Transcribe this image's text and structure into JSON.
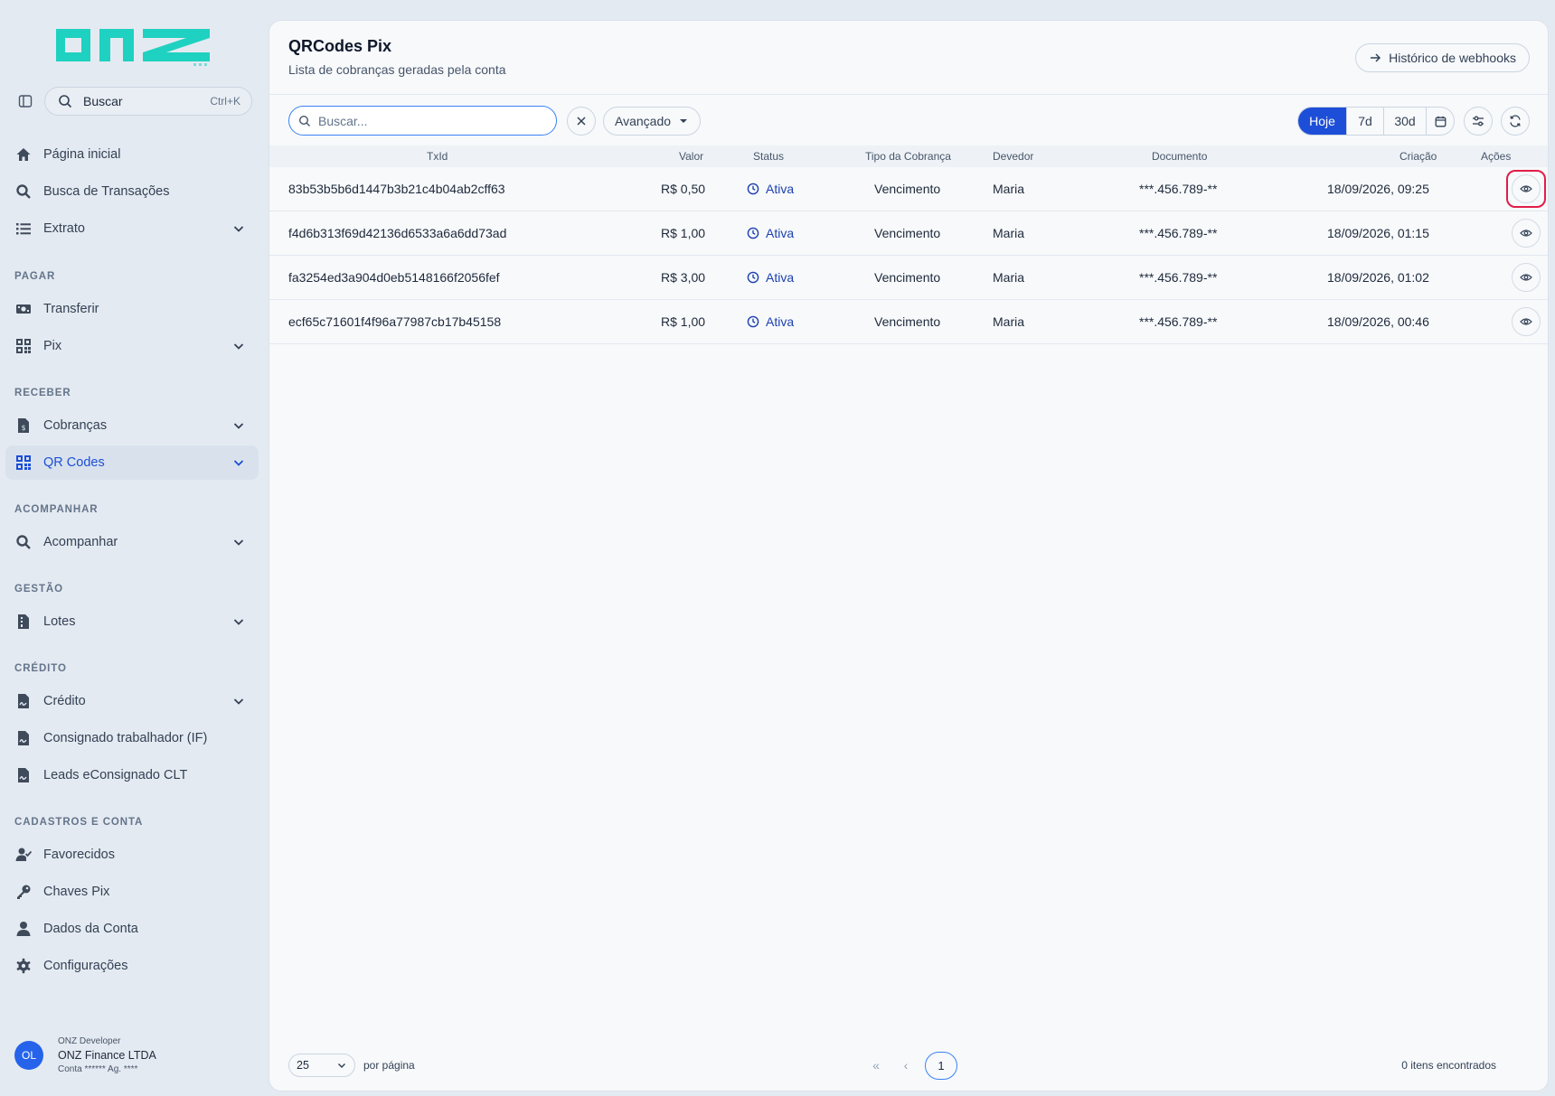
{
  "brand": {
    "logo_text": "onz",
    "accent": "#1fd1c1"
  },
  "sidebar": {
    "search": {
      "label": "Buscar",
      "shortcut": "Ctrl+K"
    },
    "items": [
      {
        "label": "Página inicial",
        "icon": "home-icon"
      },
      {
        "label": "Busca de Transações",
        "icon": "search-icon"
      },
      {
        "label": "Extrato",
        "icon": "list-icon"
      }
    ],
    "sections": {
      "pagar": "PAGAR",
      "receber": "RECEBER",
      "acompanhar": "ACOMPANHAR",
      "gestao": "GESTÃO",
      "credito": "CRÉDITO",
      "cadastros": "CADASTROS E CONTA"
    },
    "pagar": {
      "transferir": "Transferir",
      "pix": "Pix"
    },
    "receber": {
      "cobrancas": "Cobranças",
      "qrcodes": "QR Codes"
    },
    "acompanhar": {
      "acompanhar": "Acompanhar"
    },
    "gestao": {
      "lotes": "Lotes"
    },
    "credito": {
      "credito": "Crédito",
      "consignado": "Consignado trabalhador (IF)",
      "leads": "Leads eConsignado CLT"
    },
    "cadastros": {
      "favorecidos": "Favorecidos",
      "chaves": "Chaves Pix",
      "dados": "Dados da Conta",
      "config": "Configurações"
    },
    "user": {
      "initials": "OL",
      "role": "ONZ Developer",
      "name": "ONZ Finance LTDA",
      "account": "Conta ****** Ag. ****"
    }
  },
  "main": {
    "title": "QRCodes Pix",
    "subtitle": "Lista de cobranças geradas pela conta",
    "webhook_button": "Histórico de webhooks",
    "search_placeholder": "Buscar...",
    "advanced": "Avançado",
    "ranges": [
      "Hoje",
      "7d",
      "30d"
    ],
    "columns": {
      "txid": "TxId",
      "valor": "Valor",
      "status": "Status",
      "tipo": "Tipo da Cobrança",
      "devedor": "Devedor",
      "documento": "Documento",
      "criacao": "Criação",
      "acoes": "Ações"
    },
    "rows": [
      {
        "txid": "83b53b5b6d1447b3b21c4b04ab2cff63",
        "valor": "R$ 0,50",
        "status": "Ativa",
        "tipo": "Vencimento",
        "devedor": "Maria",
        "documento": "***.456.789-**",
        "criacao": "18/09/2026, 09:25"
      },
      {
        "txid": "f4d6b313f69d42136d6533a6a6dd73ad",
        "valor": "R$ 1,00",
        "status": "Ativa",
        "tipo": "Vencimento",
        "devedor": "Maria",
        "documento": "***.456.789-**",
        "criacao": "18/09/2026, 01:15"
      },
      {
        "txid": "fa3254ed3a904d0eb5148166f2056fef",
        "valor": "R$ 3,00",
        "status": "Ativa",
        "tipo": "Vencimento",
        "devedor": "Maria",
        "documento": "***.456.789-**",
        "criacao": "18/09/2026, 01:02"
      },
      {
        "txid": "ecf65c71601f4f96a77987cb17b45158",
        "valor": "R$ 1,00",
        "status": "Ativa",
        "tipo": "Vencimento",
        "devedor": "Maria",
        "documento": "***.456.789-**",
        "criacao": "18/09/2026, 00:46"
      }
    ],
    "footer": {
      "page_size": "25",
      "per_page": "por página",
      "first": "«",
      "prev": "‹",
      "page": "1",
      "found": "0 itens encontrados"
    }
  }
}
